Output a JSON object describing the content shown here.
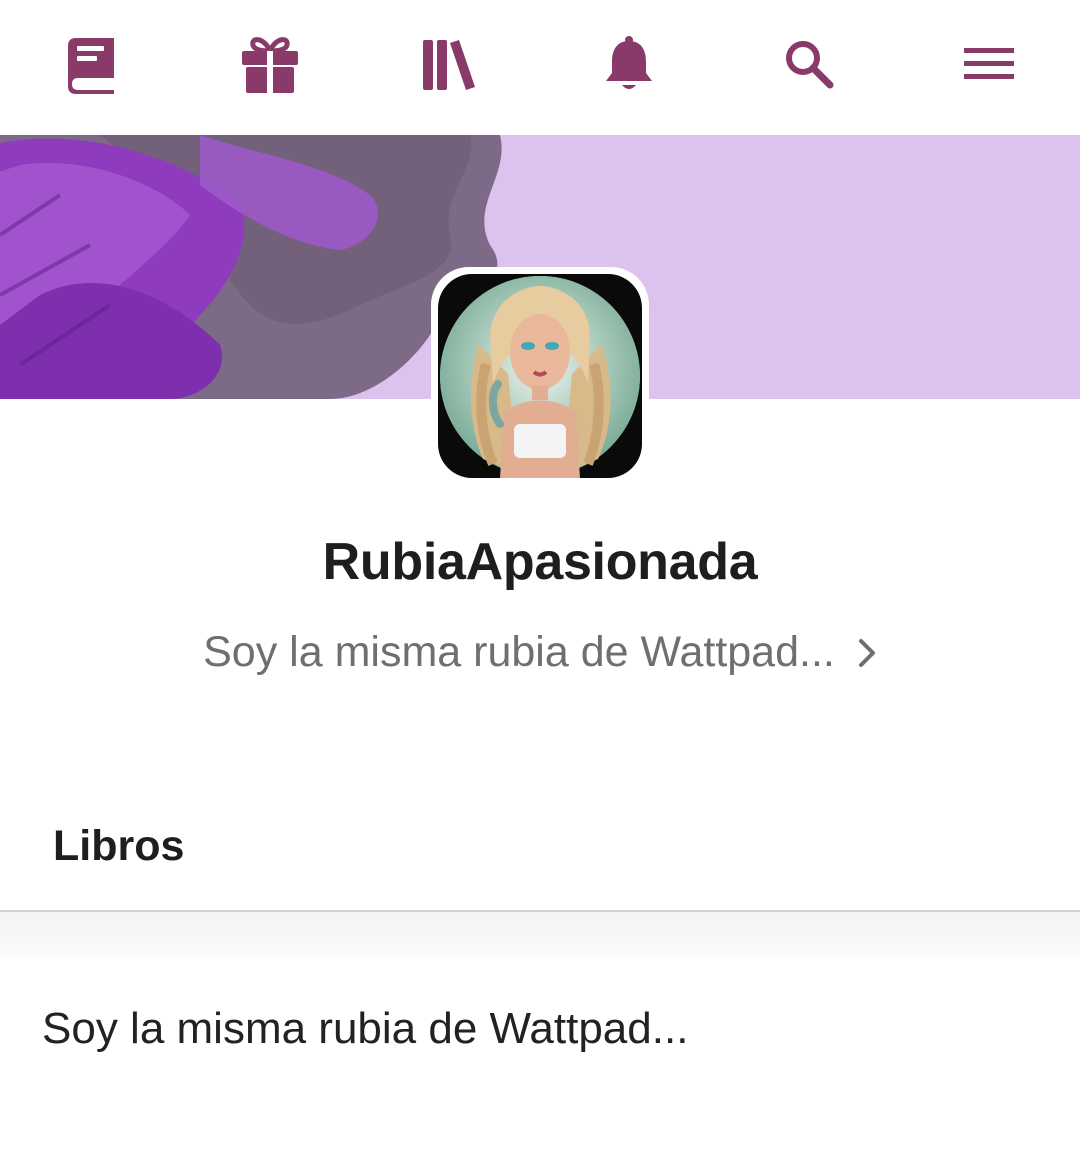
{
  "theme": {
    "accent": "#8a3a69",
    "banner_base": "#dcc2ee"
  },
  "nav": {
    "items": [
      {
        "id": "write",
        "icon": "book-write-icon"
      },
      {
        "id": "gift",
        "icon": "gift-icon"
      },
      {
        "id": "library",
        "icon": "library-icon"
      },
      {
        "id": "notifications",
        "icon": "bell-icon"
      },
      {
        "id": "search",
        "icon": "search-icon"
      },
      {
        "id": "menu",
        "icon": "hamburger-menu-icon"
      }
    ]
  },
  "profile": {
    "username": "RubiaApasionada",
    "tagline": "Soy la misma rubia de Wattpad..."
  },
  "tabs": {
    "libros": "Libros"
  },
  "about": {
    "text": "Soy la misma rubia de Wattpad..."
  }
}
